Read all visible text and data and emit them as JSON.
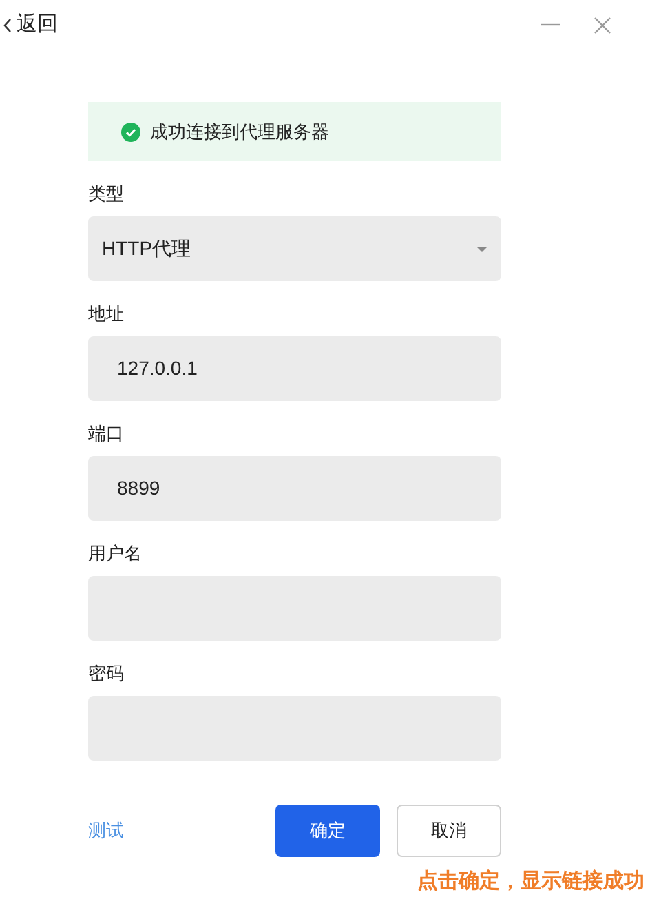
{
  "header": {
    "back": "返回"
  },
  "notice": {
    "text": "成功连接到代理服务器"
  },
  "fields": [
    {
      "kind": "select",
      "label": "类型",
      "value": "HTTP代理"
    },
    {
      "kind": "text",
      "label": "地址",
      "value": "127.0.0.1"
    },
    {
      "kind": "text",
      "label": "端口",
      "value": "8899"
    },
    {
      "kind": "text",
      "label": "用户名"
    },
    {
      "kind": "password",
      "label": "密码"
    }
  ],
  "footer": {
    "test_link": "测试",
    "confirm": "确定",
    "cancel": "取消"
  },
  "annotation": "点击确定，显示链接成功"
}
